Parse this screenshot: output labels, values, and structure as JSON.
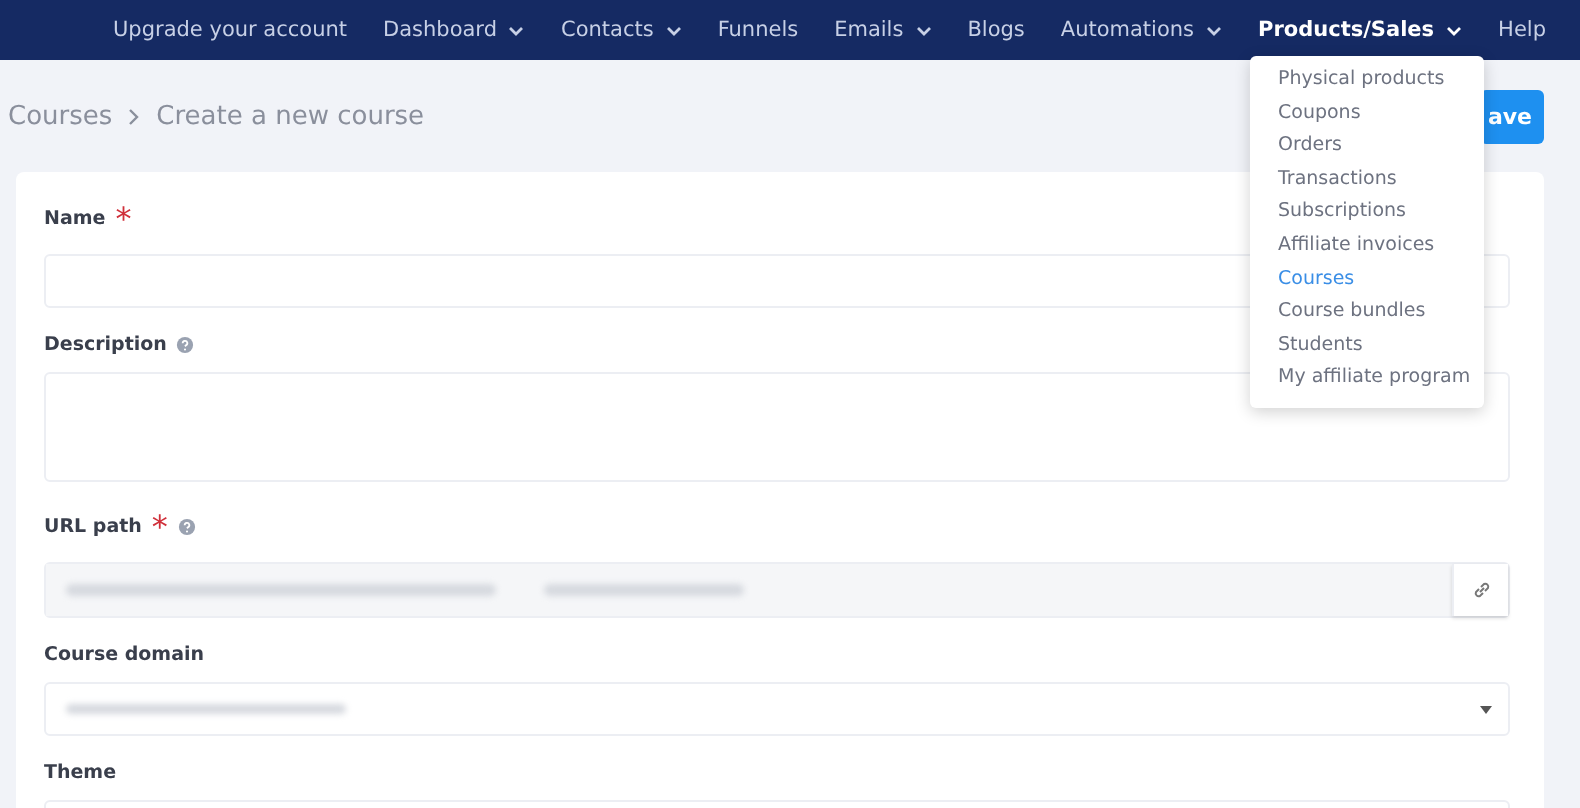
{
  "nav": {
    "items": [
      {
        "label": "Upgrade your account",
        "has_menu": false,
        "selected": false
      },
      {
        "label": "Dashboard",
        "has_menu": true,
        "selected": false
      },
      {
        "label": "Contacts",
        "has_menu": true,
        "selected": false
      },
      {
        "label": "Funnels",
        "has_menu": false,
        "selected": false
      },
      {
        "label": "Emails",
        "has_menu": true,
        "selected": false
      },
      {
        "label": "Blogs",
        "has_menu": false,
        "selected": false
      },
      {
        "label": "Automations",
        "has_menu": true,
        "selected": false
      },
      {
        "label": "Products/Sales",
        "has_menu": true,
        "selected": true
      },
      {
        "label": "Help",
        "has_menu": false,
        "selected": false
      }
    ]
  },
  "dropdown": {
    "items": [
      {
        "label": "Physical products",
        "selected": false
      },
      {
        "label": "Coupons",
        "selected": false
      },
      {
        "label": "Orders",
        "selected": false
      },
      {
        "label": "Transactions",
        "selected": false
      },
      {
        "label": "Subscriptions",
        "selected": false
      },
      {
        "label": "Affiliate invoices",
        "selected": false
      },
      {
        "label": "Courses",
        "selected": true
      },
      {
        "label": "Course bundles",
        "selected": false
      },
      {
        "label": "Students",
        "selected": false
      },
      {
        "label": "My affiliate program",
        "selected": false
      }
    ]
  },
  "breadcrumb": [
    "Courses",
    "Create a new course"
  ],
  "save_button": {
    "label": "ave"
  },
  "form": {
    "fields": [
      {
        "kind": "text",
        "label": "Name",
        "required_mark": "*",
        "help": false
      },
      {
        "kind": "textarea",
        "label": "Description",
        "help": true
      },
      {
        "kind": "url",
        "label": "URL path",
        "required_mark": "*",
        "help": true
      },
      {
        "kind": "select",
        "label": "Course domain",
        "help": false
      },
      {
        "kind": "text",
        "label": "Theme",
        "help": false
      }
    ]
  }
}
